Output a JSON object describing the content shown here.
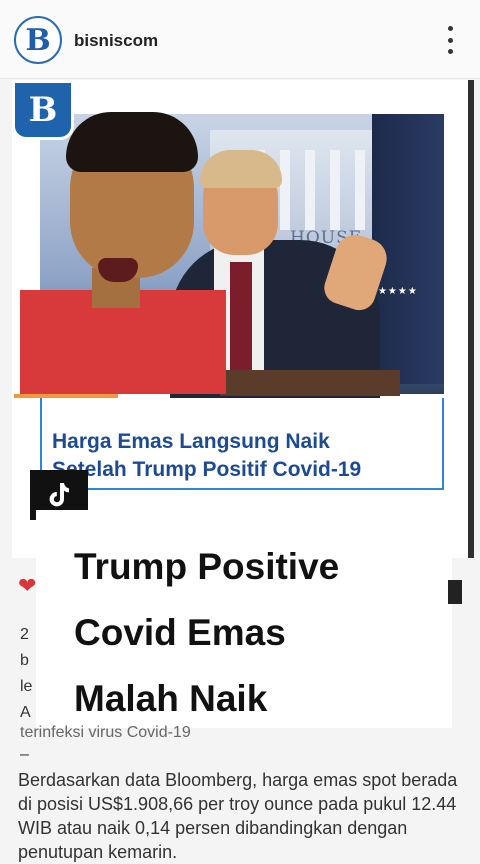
{
  "header": {
    "username": "bisniscom",
    "avatar_letter": "B"
  },
  "post": {
    "badge_letter": "B",
    "headline_line1": "Harga Emas Langsung Naik",
    "headline_line2": "Setelah Trump Positif Covid-19",
    "photo_text": "HOUSE"
  },
  "overlay": {
    "title_line1": "Trump Positive",
    "title_line2": "Covid Emas",
    "title_line3": "Malah Naik"
  },
  "caption": {
    "partial_lines": [
      "2",
      "b",
      "le",
      "A"
    ],
    "hidden_line": "terinfeksi virus Covid-19",
    "dash": "–",
    "body": "Berdasarkan data Bloomberg, harga emas spot berada di posisi US$1.908,66 per troy ounce pada pukul 12.44 WIB atau naik 0,14 persen dibandingkan dengan penutupan kemarin."
  },
  "colors": {
    "brand_blue": "#1f63ad",
    "headline_blue": "#1d4b92",
    "accent_orange": "#f29a3b"
  },
  "icons": [
    "more-icon",
    "tiktok-icon",
    "heart-icon",
    "bookmark-icon"
  ]
}
